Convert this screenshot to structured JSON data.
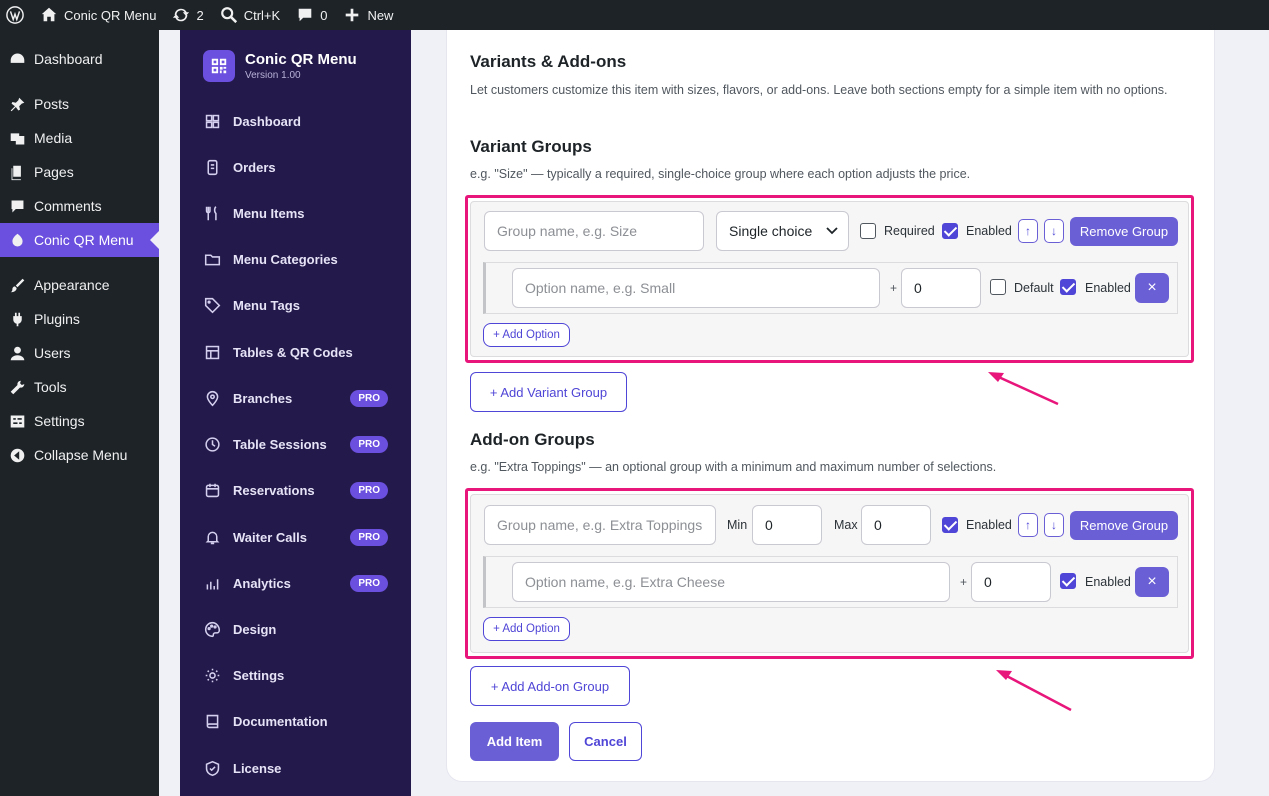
{
  "adminbar": {
    "site_name": "Conic QR Menu",
    "updates_count": "2",
    "search_label": "Ctrl+K",
    "comments_count": "0",
    "new_label": "New"
  },
  "wp_menu": {
    "items": [
      "Dashboard",
      "Posts",
      "Media",
      "Pages",
      "Comments",
      "Conic QR Menu",
      "Appearance",
      "Plugins",
      "Users",
      "Tools",
      "Settings",
      "Collapse Menu"
    ]
  },
  "plugin": {
    "name": "Conic QR Menu",
    "version": "Version 1.00",
    "pro_badge": "PRO",
    "nav": [
      "Dashboard",
      "Orders",
      "Menu Items",
      "Menu Categories",
      "Menu Tags",
      "Tables & QR Codes",
      "Branches",
      "Table Sessions",
      "Reservations",
      "Waiter Calls",
      "Analytics",
      "Design",
      "Settings",
      "Documentation",
      "License"
    ]
  },
  "form": {
    "title": "Variants & Add-ons",
    "description": "Let customers customize this item with sizes, flavors, or add-ons. Leave both sections empty for a simple item with no options.",
    "variant_groups": {
      "heading": "Variant Groups",
      "hint": "e.g. \"Size\" — typically a required, single-choice group where each option adjusts the price.",
      "group_name_placeholder": "Group name, e.g. Size",
      "choice_type": "Single choice",
      "required_label": "Required",
      "enabled_label": "Enabled",
      "up_label": "↑",
      "down_label": "↓",
      "remove_label": "Remove Group",
      "option_placeholder": "Option name, e.g. Small",
      "plus": "+",
      "option_price": "0",
      "default_label": "Default",
      "option_enabled_label": "Enabled",
      "close_label": "×",
      "add_option_label": "+ Add Option",
      "add_group_label": "+ Add Variant Group",
      "required_checked": false,
      "enabled_checked": true,
      "default_checked": false,
      "option_enabled_checked": true
    },
    "addon_groups": {
      "heading": "Add-on Groups",
      "hint": "e.g. \"Extra Toppings\" — an optional group with a minimum and maximum number of selections.",
      "group_name_placeholder": "Group name, e.g. Extra Toppings",
      "min_label": "Min",
      "min_value": "0",
      "max_label": "Max",
      "max_value": "0",
      "enabled_label": "Enabled",
      "up_label": "↑",
      "down_label": "↓",
      "remove_label": "Remove Group",
      "option_placeholder": "Option name, e.g. Extra Cheese",
      "plus": "+",
      "option_price": "0",
      "option_enabled_label": "Enabled",
      "close_label": "×",
      "add_option_label": "+ Add Option",
      "add_group_label": "+ Add Add-on Group",
      "enabled_checked": true,
      "option_enabled_checked": true
    },
    "submit_label": "Add Item",
    "cancel_label": "Cancel"
  },
  "colors": {
    "accent": "#6b5fd6",
    "highlight": "#e8157b",
    "plugin_sidebar": "#23194a",
    "wp_sidebar": "#1d2327"
  }
}
